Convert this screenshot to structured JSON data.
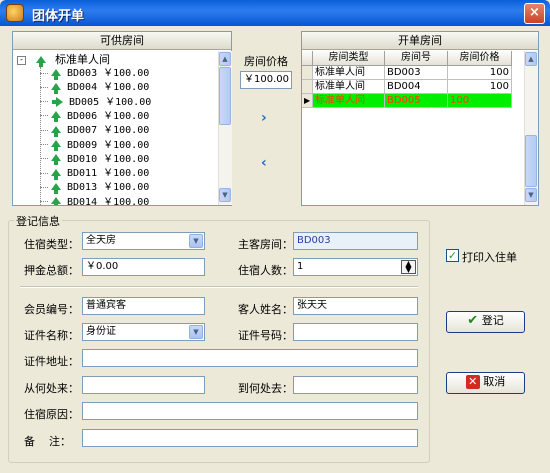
{
  "window": {
    "title": "团体开单",
    "close_glyph": "×"
  },
  "available_rooms": {
    "header": "可供房间",
    "category": "标准单人间",
    "rooms": [
      {
        "number": "BD003",
        "price": "￥100.00",
        "selected": false
      },
      {
        "number": "BD004",
        "price": "￥100.00",
        "selected": false
      },
      {
        "number": "BD005",
        "price": "￥100.00",
        "selected": true
      },
      {
        "number": "BD006",
        "price": "￥100.00",
        "selected": false
      },
      {
        "number": "BD007",
        "price": "￥100.00",
        "selected": false
      },
      {
        "number": "BD009",
        "price": "￥100.00",
        "selected": false
      },
      {
        "number": "BD010",
        "price": "￥100.00",
        "selected": false
      },
      {
        "number": "BD011",
        "price": "￥100.00",
        "selected": false
      },
      {
        "number": "BD013",
        "price": "￥100.00",
        "selected": false
      },
      {
        "number": "BD014",
        "price": "￥100.00",
        "selected": false
      }
    ]
  },
  "room_price": {
    "label": "房间价格",
    "value": "￥100.00"
  },
  "transfer": {
    "add_glyph": "›",
    "remove_glyph": "‹"
  },
  "opened_rooms": {
    "header": "开单房间",
    "columns": [
      "房间类型",
      "房间号",
      "房间价格"
    ],
    "rows": [
      {
        "type": "标准单人间",
        "number": "BD003",
        "price": "100",
        "highlight": false
      },
      {
        "type": "标准单人间",
        "number": "BD004",
        "price": "100",
        "highlight": false
      },
      {
        "type": "标准单人间",
        "number": "BD005",
        "price": "100",
        "highlight": true
      }
    ]
  },
  "registration": {
    "group_title": "登记信息",
    "stay_type_label": "住宿类型：",
    "stay_type_value": "全天房",
    "main_room_label": "主客房间：",
    "main_room_value": "BD003",
    "deposit_label": "押金总额：",
    "deposit_value": "￥0.00",
    "guest_count_label": "住宿人数：",
    "guest_count_value": "1",
    "member_no_label": "会员编号：",
    "member_no_value": "普通宾客",
    "guest_name_label": "客人姓名：",
    "guest_name_value": "张天天",
    "id_type_label": "证件名称：",
    "id_type_value": "身份证",
    "id_number_label": "证件号码：",
    "id_number_value": "",
    "id_address_label": "证件地址：",
    "id_address_value": "",
    "from_label": "从何处来：",
    "from_value": "",
    "to_label": "到何处去：",
    "to_value": "",
    "reason_label": "住宿原因：",
    "reason_value": "",
    "remark_label": "备    注：",
    "remark_value": ""
  },
  "print_checkin": {
    "label": "打印入住单",
    "checked": true
  },
  "actions": {
    "register_label": "登记",
    "cancel_label": "取消"
  },
  "colors": {
    "highlight_row": "#00ee00",
    "highlight_text": "#ff3b00",
    "accent": "#1f6fd0"
  }
}
